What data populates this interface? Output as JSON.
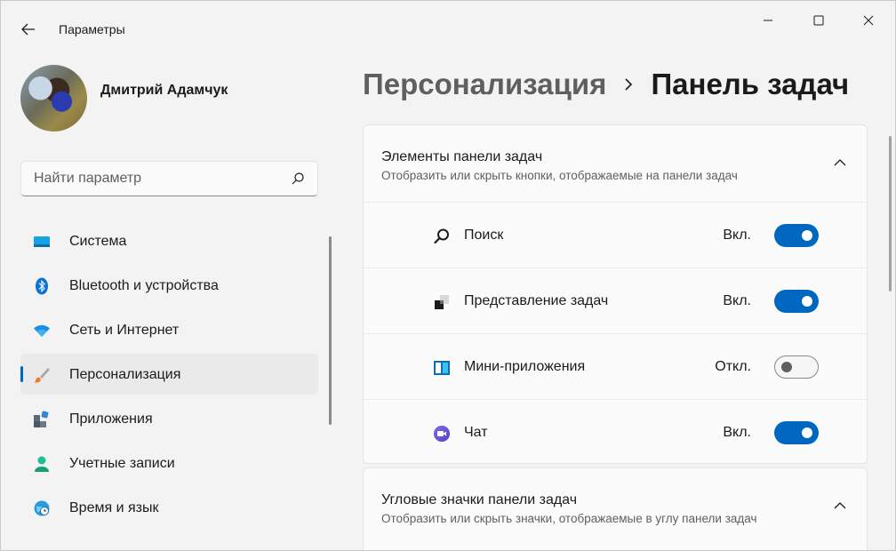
{
  "window": {
    "title": "Параметры"
  },
  "user": {
    "name": "Дмитрий Адамчук"
  },
  "search": {
    "placeholder": "Найти параметр"
  },
  "sidebar": {
    "items": [
      {
        "label": "Система",
        "icon": "system-icon"
      },
      {
        "label": "Bluetooth и устройства",
        "icon": "bluetooth-icon"
      },
      {
        "label": "Сеть и Интернет",
        "icon": "wifi-icon"
      },
      {
        "label": "Персонализация",
        "icon": "brush-icon",
        "active": true
      },
      {
        "label": "Приложения",
        "icon": "apps-icon"
      },
      {
        "label": "Учетные записи",
        "icon": "user-icon"
      },
      {
        "label": "Время и язык",
        "icon": "globe-clock-icon"
      }
    ]
  },
  "breadcrumb": {
    "parent": "Персонализация",
    "separator_icon": "chevron-right-icon",
    "current": "Панель задач"
  },
  "sections": [
    {
      "title": "Элементы панели задач",
      "subtitle": "Отобразить или скрыть кнопки, отображаемые на панели задач",
      "expanded": true,
      "items": [
        {
          "label": "Поиск",
          "state": "Вкл.",
          "on": true,
          "icon": "search-icon"
        },
        {
          "label": "Представление задач",
          "state": "Вкл.",
          "on": true,
          "icon": "task-view-icon"
        },
        {
          "label": "Мини-приложения",
          "state": "Откл.",
          "on": false,
          "icon": "widgets-icon"
        },
        {
          "label": "Чат",
          "state": "Вкл.",
          "on": true,
          "icon": "chat-icon"
        }
      ]
    },
    {
      "title": "Угловые значки панели задач",
      "subtitle": "Отобразить или скрыть значки, отображаемые в углу панели задач",
      "expanded": true
    }
  ],
  "colors": {
    "accent": "#0067c0",
    "background": "#f3f3f3",
    "card": "#fbfbfb",
    "text_secondary": "#5f5f5f"
  }
}
